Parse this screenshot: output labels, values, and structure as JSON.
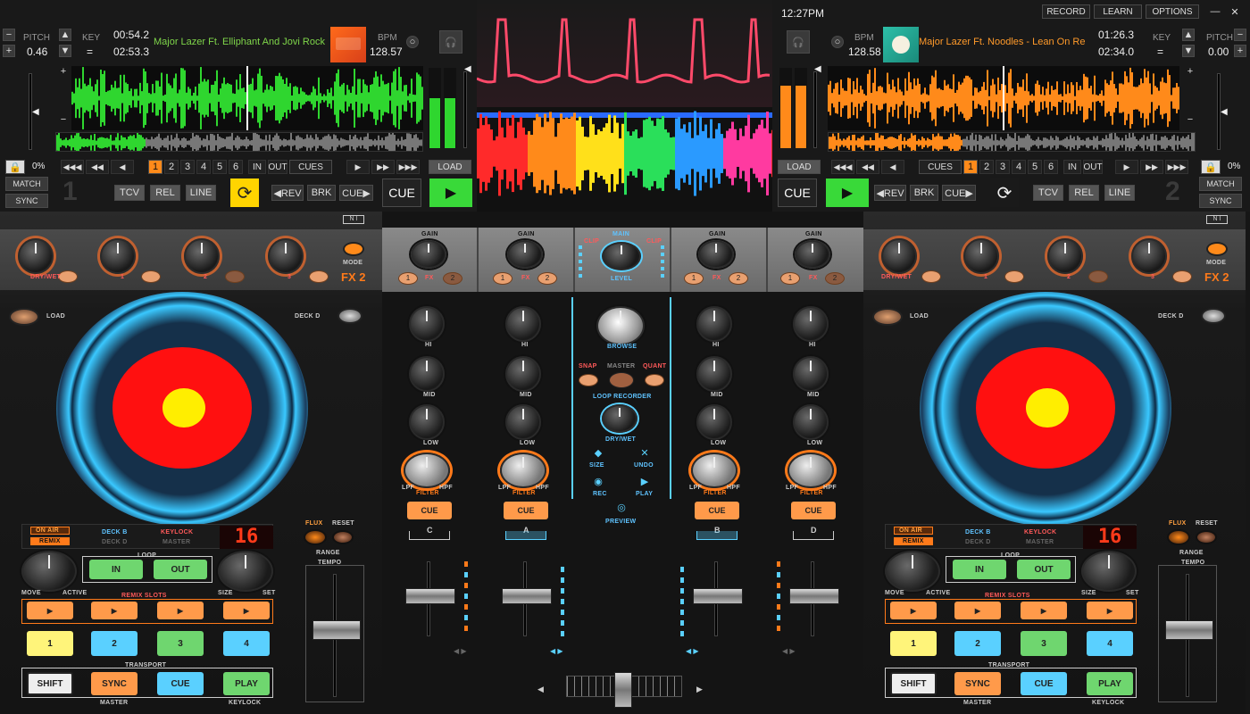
{
  "deck1": {
    "pitch_label": "PITCH",
    "pitch_value": "0.46",
    "key_label": "KEY",
    "key_value": "=",
    "elapsed": "00:54.2",
    "remaining": "02:53.3",
    "track": "Major Lazer Ft. Elliphant And Jovi Rock",
    "bpm_label": "BPM",
    "bpm_value": "128.57",
    "pct": "0%",
    "match": "MATCH",
    "sync": "SYNC",
    "deck_num": "1",
    "transport_icons": [
      "skip-back-icon",
      "rewind-icon",
      "back-icon"
    ],
    "cues": [
      "1",
      "2",
      "3",
      "4",
      "5",
      "6"
    ],
    "in": "IN",
    "out": "OUT",
    "cues_label": "CUES",
    "load": "LOAD",
    "tcv": "TCV",
    "rel": "REL",
    "line": "LINE",
    "rev": "◀REV",
    "brk": "BRK",
    "cue_arrow": "CUE▶",
    "cue": "CUE",
    "wave_color": "#2fd62f"
  },
  "deck2": {
    "pitch_label": "PITCH",
    "pitch_value": "0.00",
    "key_label": "KEY",
    "key_value": "=",
    "elapsed": "01:26.3",
    "remaining": "02:34.0",
    "track": "Major Lazer Ft. Noodles - Lean On Re",
    "bpm_label": "BPM",
    "bpm_value": "128.58",
    "pct": "0%",
    "match": "MATCH",
    "sync": "SYNC",
    "deck_num": "2",
    "cues": [
      "1",
      "2",
      "3",
      "4",
      "5",
      "6"
    ],
    "in": "IN",
    "out": "OUT",
    "cues_label": "CUES",
    "load": "LOAD",
    "tcv": "TCV",
    "rel": "REL",
    "line": "LINE",
    "rev": "◀REV",
    "brk": "BRK",
    "cue_arrow": "CUE▶",
    "cue": "CUE",
    "wave_color": "#ff8a1a"
  },
  "topbar": {
    "clock": "12:27PM",
    "record": "RECORD",
    "learn": "LEARN",
    "options": "OPTIONS",
    "minimize": "—",
    "close": "✕"
  },
  "fx": {
    "labels": [
      "DRY/WET",
      "1",
      "2",
      "3"
    ],
    "mode": "MODE",
    "name": "FX 2"
  },
  "controller": {
    "load": "LOAD",
    "deck_d": "DECK D",
    "on_air": "ON AIR",
    "remix": "REMIX",
    "deck_b": "DECK B",
    "deck_d2": "DECK D",
    "keylock": "KEYLOCK",
    "master": "MASTER",
    "display": "16",
    "flux": "FLUX",
    "reset": "RESET",
    "range": "RANGE",
    "tempo": "TEMPO",
    "loop": "LOOP",
    "in": "IN",
    "out": "OUT",
    "move": "MOVE",
    "active": "ACTIVE",
    "size": "SIZE",
    "set": "SET",
    "remix_slots": "REMIX SLOTS",
    "slot_glyph": "▶",
    "pads": [
      "1",
      "2",
      "3",
      "4"
    ],
    "transport": "TRANSPORT",
    "shift": "SHIFT",
    "sync": "SYNC",
    "cue": "CUE",
    "play": "PLAY",
    "master_label": "MASTER",
    "keylock_label": "KEYLOCK",
    "ni_logo": "N I"
  },
  "mixer": {
    "gain": "GAIN",
    "main": "MAIN",
    "level": "LEVEL",
    "clip": "CLIP",
    "hi": "HI",
    "mid": "MID",
    "low": "LOW",
    "filter": "FILTER",
    "lpf": "LPF",
    "hpf": "HPF",
    "cue": "CUE",
    "fx": "FX",
    "fx_nums": [
      "1",
      "2"
    ],
    "channels": [
      "C",
      "A",
      "B",
      "D"
    ],
    "browse": "BROWSE",
    "snap": "SNAP",
    "master": "MASTER",
    "quant": "QUANT",
    "loop_recorder": "LOOP RECORDER",
    "dry_wet": "DRY/WET",
    "size": "SIZE",
    "undo": "UNDO",
    "rec": "REC",
    "play": "PLAY",
    "preview": "PREVIEW"
  },
  "colors": {
    "green": "#2fd62f",
    "orange": "#ff8a1a",
    "accent_orange": "#ffa23f",
    "platter_red": "#ff1010",
    "platter_yellow": "#ffee00",
    "ring_blue": "#3ac8ff"
  }
}
